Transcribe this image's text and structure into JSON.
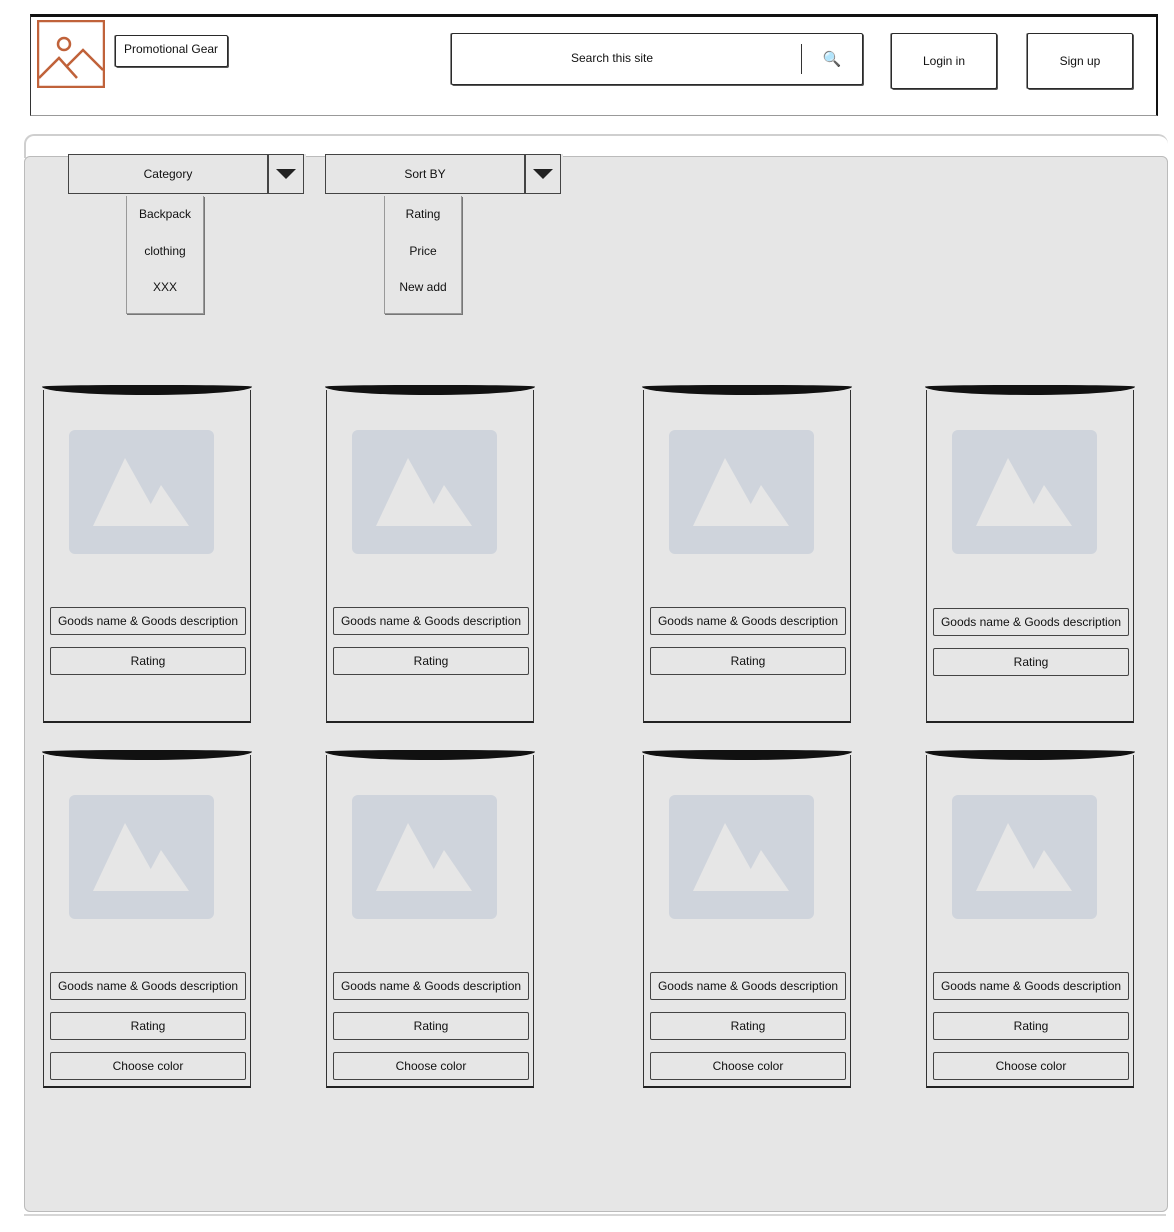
{
  "header": {
    "brand": "Promotional Gear",
    "search_placeholder": "Search this site",
    "login_label": "Login in",
    "signup_label": "Sign up",
    "logo_color": "#c0623a"
  },
  "filters": {
    "category": {
      "label": "Category",
      "options": [
        "Backpack",
        "clothing",
        "XXX"
      ]
    },
    "sort": {
      "label": "Sort BY",
      "options": [
        "Rating",
        "Price",
        "New add"
      ]
    }
  },
  "products": {
    "row1": [
      {
        "name": "Goods name & Goods description",
        "rating": "Rating"
      },
      {
        "name": "Goods name & Goods description",
        "rating": "Rating"
      },
      {
        "name": "Goods name & Goods description",
        "rating": "Rating"
      },
      {
        "name": "Goods name & Goods description",
        "rating": "Rating"
      }
    ],
    "row2": [
      {
        "name": "Goods name & Goods description",
        "rating": "Rating",
        "color": "Choose color"
      },
      {
        "name": "Goods name & Goods description",
        "rating": "Rating",
        "color": "Choose color"
      },
      {
        "name": "Goods name & Goods description",
        "rating": "Rating",
        "color": "Choose color"
      },
      {
        "name": "Goods name & Goods description",
        "rating": "Rating",
        "color": "Choose color"
      }
    ]
  }
}
